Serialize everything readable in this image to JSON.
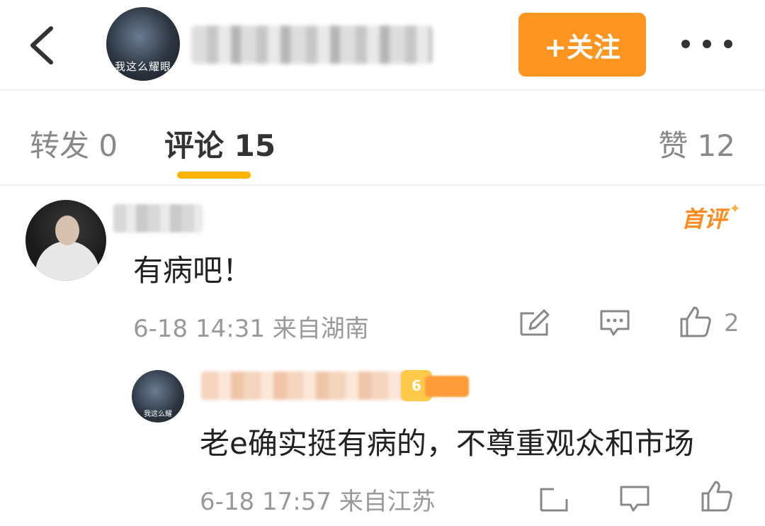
{
  "header": {
    "avatar_caption": "我这么耀眼",
    "follow_label": "+关注"
  },
  "tabs": {
    "repost": "转发 0",
    "comments": "评论 15",
    "likes": "赞 12"
  },
  "comments": [
    {
      "badge": "首评",
      "text": "有病吧！",
      "meta": "6-18 14:31 来自湖南",
      "likes": "2"
    }
  ],
  "reply": {
    "avatar_caption": "我这么耀",
    "vip_level": "6",
    "text": "老e确实挺有病的，不尊重观众和市场",
    "meta": "6-18 17:57 来自江苏"
  },
  "colors": {
    "accent": "#ff9521",
    "tab_indicator": "#ffb300",
    "first_badge": "#ff8a1f"
  },
  "icons": [
    "back-arrow-icon",
    "more-icon",
    "repost-icon",
    "comment-icon",
    "like-icon",
    "vip-crown-icon"
  ]
}
